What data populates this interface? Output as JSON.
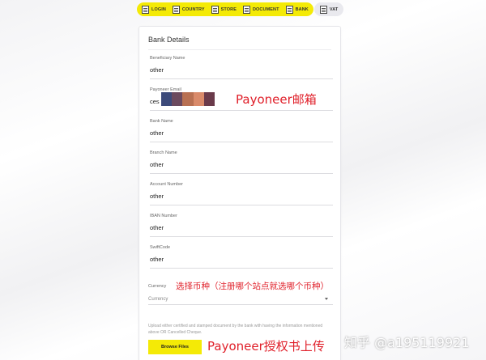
{
  "stepper": {
    "steps": [
      {
        "label": "LOGIN",
        "icon": "document-icon",
        "state": "completed"
      },
      {
        "label": "COUNTRY",
        "icon": "document-icon",
        "state": "completed"
      },
      {
        "label": "STORE",
        "icon": "document-icon",
        "state": "completed"
      },
      {
        "label": "DOCUMENT",
        "icon": "document-icon",
        "state": "completed"
      },
      {
        "label": "BANK",
        "icon": "document-icon",
        "state": "active"
      },
      {
        "label": "VAT",
        "icon": "document-icon",
        "state": "pending"
      }
    ],
    "active_color": "#f4ea06",
    "inactive_color": "#e9e9ee"
  },
  "card": {
    "title": "Bank Details",
    "fields": [
      {
        "label": "Beneficiary Name",
        "value": "other"
      },
      {
        "label": "Payoneer Email",
        "value": "ces                      n"
      },
      {
        "label": "Bank Name",
        "value": "other"
      },
      {
        "label": "Branch Name",
        "value": "other"
      },
      {
        "label": "Account Number",
        "value": "other"
      },
      {
        "label": "IBAN Number",
        "value": "other"
      },
      {
        "label": "SwiftCode",
        "value": "other"
      }
    ],
    "currency": {
      "label": "Currency",
      "placeholder": "Currency"
    },
    "upload_text": "Upload either certified and stamped document by the bank with having the information mentioned above OR Cancelled Cheque.",
    "browse_button": "Browse Files"
  },
  "annotations": {
    "email": "Payoneer邮箱",
    "currency": "选择币种（注册哪个站点就选哪个币种）",
    "upload": "Payoneer授权书上传",
    "color": "#e0202a"
  },
  "watermark": "知乎 @a195119921"
}
